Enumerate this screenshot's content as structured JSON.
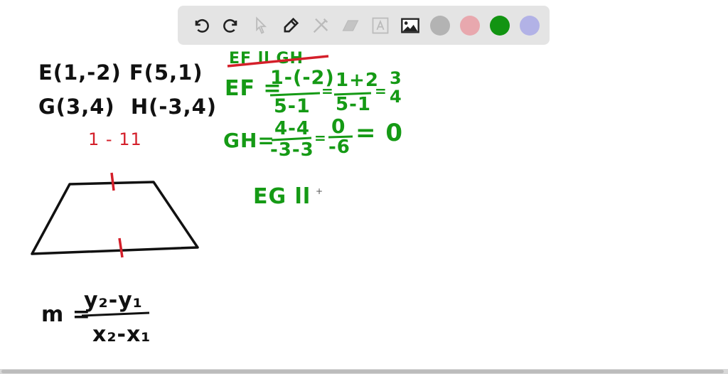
{
  "toolbar": {
    "tools": [
      "undo-icon",
      "redo-icon",
      "select-icon",
      "pen-icon",
      "tools-icon",
      "eraser-icon",
      "text-icon",
      "image-icon"
    ],
    "colors": {
      "gray": "#b3b3b3",
      "pink": "#e8a8ae",
      "green": "#129412",
      "lavender": "#b2b2e6"
    },
    "selected_color": "green"
  },
  "board": {
    "points_line1": "E(1,-2) F(5,1)",
    "points_line2": "G(3,4)  H(-3,4)",
    "red_note": "1 - 11",
    "formula_m": "m =",
    "formula_num": "y₂-y₁",
    "formula_den": "x₂-x₁",
    "struck": "EF ll GH",
    "ef_label": "EF =",
    "ef_num": "1-(-2)",
    "ef_den": "5-1",
    "ef_eq2": "=",
    "ef_num2": "1+2",
    "ef_den2": "5-1",
    "ef_eq3": "=",
    "ef_num3": "3",
    "ef_den3": "4",
    "gh_label": "GH=",
    "gh_num": "4-4",
    "gh_den": "-3-3",
    "gh_eq2": "=",
    "gh_num2": "0",
    "gh_den2": "-6",
    "gh_result": "= 0",
    "eg": "EG ll"
  }
}
